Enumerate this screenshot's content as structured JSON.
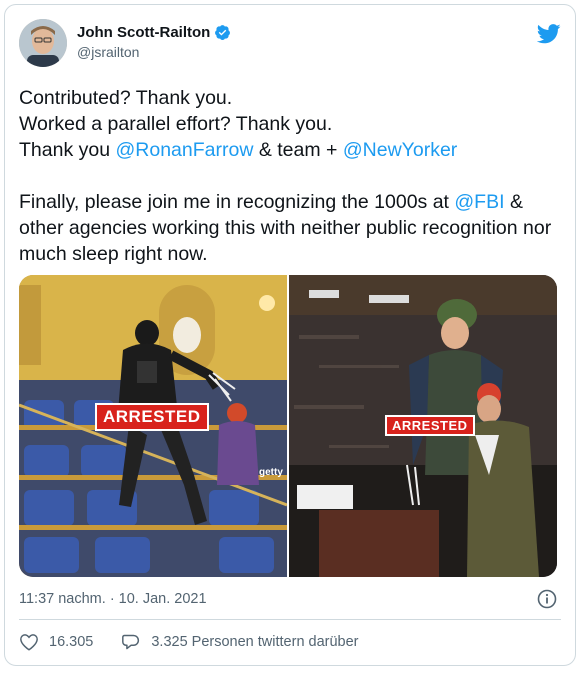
{
  "author": {
    "name": "John Scott-Railton",
    "handle": "@jsrailton"
  },
  "tweet": {
    "line1": "Contributed? Thank you.",
    "line2": "Worked a parallel effort? Thank you.",
    "line3_a": "Thank you ",
    "line3_mention1": "@RonanFarrow",
    "line3_b": " & team + ",
    "line3_mention2": "@NewYorker",
    "para2_a": "Finally, please join me in recognizing the 1000s at ",
    "para2_mention": "@FBI",
    "para2_b": " & other agencies working this with neither public recognition nor much sleep right now."
  },
  "media": {
    "photo1_badge": "ARRESTED",
    "photo1_credit": "getty",
    "photo2_badge": "ARRESTED"
  },
  "meta": {
    "timestamp": "11:37 nachm. · 10. Jan. 2021"
  },
  "actions": {
    "likes": "16.305",
    "talking": "3.325 Personen twittern darüber"
  },
  "colors": {
    "link": "#1d9bf0",
    "muted": "#536471",
    "badge": "#d8221c"
  },
  "icons": [
    "verified-badge-icon",
    "twitter-bird-icon",
    "info-icon",
    "heart-icon",
    "reply-bubble-icon"
  ]
}
